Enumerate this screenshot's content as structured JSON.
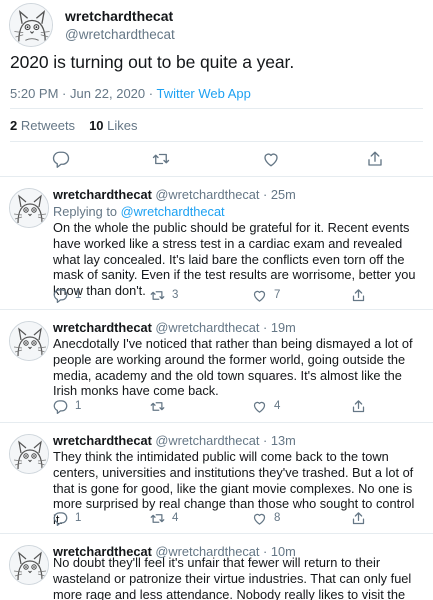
{
  "main_tweet": {
    "display_name": "wretchardthecat",
    "handle": "@wretchardthecat",
    "text": "2020 is turning out to be quite a year.",
    "timestamp": "5:20 PM · Jun 22, 2020 · ",
    "source_app": "Twitter Web App",
    "retweets_count": "2",
    "retweets_label": "Retweets",
    "likes_count": "10",
    "likes_label": "Likes"
  },
  "replies": [
    {
      "display_name": "wretchardthecat",
      "handle": "@wretchardthecat",
      "time": "25m",
      "replying_prefix": "Replying to ",
      "replying_to": "@wretchardthecat",
      "text": "On the whole the public should be grateful for it. Recent events have worked like a stress test in a cardiac exam and revealed what lay concealed. It's laid bare the conflicts even torn off the mask of sanity. Even if the test results are worrisome, better you know than don't.",
      "replies_count": "1",
      "retweets_count": "3",
      "likes_count": "7"
    },
    {
      "display_name": "wretchardthecat",
      "handle": "@wretchardthecat",
      "time": "19m",
      "text": "Anecdotally I've noticed that rather than being dismayed a lot of people are working around the former world, going outside the media, academy and the old town squares. It's almost like the Irish monks have come back.",
      "replies_count": "1",
      "retweets_count": "",
      "likes_count": "4"
    },
    {
      "display_name": "wretchardthecat",
      "handle": "@wretchardthecat",
      "time": "13m",
      "text": "They think the intimidated public will come back to the town centers, universities and institutions they've trashed. But a lot of that is gone for good, like the giant movie complexes. No one is more surprised by real change than those who sought to control it.",
      "replies_count": "1",
      "retweets_count": "4",
      "likes_count": "8"
    },
    {
      "display_name": "wretchardthecat",
      "handle": "@wretchardthecat",
      "time": "10m",
      "text": "No doubt they'll feel it's unfair that fewer will return to their wasteland or patronize their virtue industries. That can only fuel more rage and less attendance. Nobody really likes to visit the Angriest Place on Earth."
    }
  ],
  "colors": {
    "accent": "#1da1f2",
    "secondary_text": "#657786",
    "primary_text": "#14171a",
    "divider": "#e6ecf0"
  },
  "icons": [
    "cat-avatar",
    "reply-icon",
    "retweet-icon",
    "like-icon",
    "share-icon"
  ]
}
